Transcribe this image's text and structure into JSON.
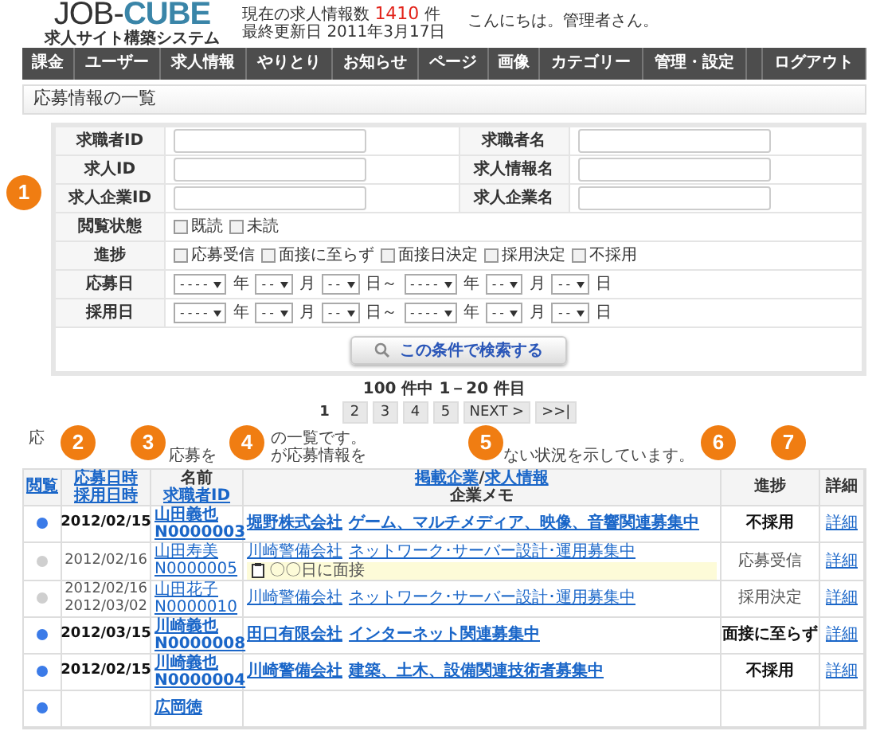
{
  "header": {
    "logo_main": "JOB-",
    "logo_accent": "CUBE",
    "logo_sub": "求人サイト構築システム",
    "count_label": "現在の求人情報数",
    "count": "1410",
    "count_unit": "件",
    "updated_label": "最終更新日",
    "updated": "2011年3月17日",
    "greeting": "こんにちは。管理者さん。"
  },
  "nav": [
    {
      "kind": "link",
      "label": "課金"
    },
    {
      "kind": "link",
      "label": "ユーザー"
    },
    {
      "kind": "link",
      "label": "求人情報"
    },
    {
      "kind": "link",
      "label": "やりとり"
    },
    {
      "kind": "link",
      "label": "お知らせ"
    },
    {
      "kind": "link",
      "label": "ページ"
    },
    {
      "kind": "link",
      "label": "画像"
    },
    {
      "kind": "link",
      "label": "カテゴリー"
    },
    {
      "kind": "link",
      "label": "管理・設定"
    },
    {
      "kind": "spacer"
    },
    {
      "kind": "link",
      "label": "ログアウト"
    }
  ],
  "page_title": "応募情報の一覧",
  "search": {
    "rows": [
      {
        "kind": "text_pair",
        "cells": [
          {
            "label": "求職者ID"
          },
          {
            "label": "求職者名"
          }
        ]
      },
      {
        "kind": "text_pair",
        "cells": [
          {
            "label": "求人ID"
          },
          {
            "label": "求人情報名"
          }
        ]
      },
      {
        "kind": "text_pair",
        "cells": [
          {
            "label": "求人企業ID"
          },
          {
            "label": "求人企業名"
          }
        ]
      },
      {
        "kind": "checks",
        "label": "閲覧状態",
        "options": [
          {
            "label": "既読",
            "checked": false
          },
          {
            "label": "未読",
            "checked": false
          }
        ]
      },
      {
        "kind": "checks",
        "label": "進捗",
        "options": [
          {
            "label": "応募受信",
            "checked": false
          },
          {
            "label": "面接に至らず",
            "checked": false
          },
          {
            "label": "面接日決定",
            "checked": false
          },
          {
            "label": "採用決定",
            "checked": false
          },
          {
            "label": "不採用",
            "checked": false
          }
        ]
      },
      {
        "kind": "dates",
        "label": "応募日",
        "parts": [
          {
            "kind": "select",
            "text": "----"
          },
          {
            "kind": "unit",
            "text": "年"
          },
          {
            "kind": "select",
            "text": "--"
          },
          {
            "kind": "unit",
            "text": "月"
          },
          {
            "kind": "select",
            "text": "--"
          },
          {
            "kind": "unit",
            "text": "日～"
          },
          {
            "kind": "select",
            "text": "----"
          },
          {
            "kind": "unit",
            "text": "年"
          },
          {
            "kind": "select",
            "text": "--"
          },
          {
            "kind": "unit",
            "text": "月"
          },
          {
            "kind": "select",
            "text": "--"
          },
          {
            "kind": "unit",
            "text": "日"
          }
        ]
      },
      {
        "kind": "dates",
        "label": "採用日",
        "parts": [
          {
            "kind": "select",
            "text": "----"
          },
          {
            "kind": "unit",
            "text": "年"
          },
          {
            "kind": "select",
            "text": "--"
          },
          {
            "kind": "unit",
            "text": "月"
          },
          {
            "kind": "select",
            "text": "--"
          },
          {
            "kind": "unit",
            "text": "日～"
          },
          {
            "kind": "select",
            "text": "----"
          },
          {
            "kind": "unit",
            "text": "年"
          },
          {
            "kind": "select",
            "text": "--"
          },
          {
            "kind": "unit",
            "text": "月"
          },
          {
            "kind": "select",
            "text": "--"
          },
          {
            "kind": "unit",
            "text": "日"
          }
        ]
      }
    ],
    "button": "この条件で検索する"
  },
  "pagination": {
    "summary": "100 件中 1－20 件目",
    "pages": [
      {
        "label": "1",
        "selected": true
      },
      {
        "label": "2",
        "selected": false
      },
      {
        "label": "3",
        "selected": false
      },
      {
        "label": "4",
        "selected": false
      },
      {
        "label": "5",
        "selected": false
      },
      {
        "label": "NEXT >",
        "selected": false
      },
      {
        "label": ">>|",
        "selected": false
      }
    ]
  },
  "description": [
    [
      "応",
      "の一覧です。"
    ],
    [
      "応募を",
      "が応募情報を",
      "ない状況を示しています。"
    ]
  ],
  "callouts": [
    "1",
    "2",
    "3",
    "4",
    "5",
    "6",
    "7"
  ],
  "table": {
    "columns": [
      {
        "lines": [
          {
            "text": "閲覧",
            "link": true
          }
        ]
      },
      {
        "lines": [
          {
            "text": "応募日時",
            "link": true
          },
          {
            "text": "採用日時",
            "link": true
          }
        ]
      },
      {
        "lines": [
          {
            "text": "名前",
            "link": false
          },
          {
            "text": "求職者ID",
            "link": true
          }
        ]
      },
      {
        "lines": [
          {
            "text": "掲載企業",
            "link": true
          },
          {
            "text": " / ",
            "link": false
          },
          {
            "text": "求人情報",
            "link": true
          },
          {
            "text": "企業メモ",
            "link": false
          }
        ]
      },
      {
        "lines": [
          {
            "text": "進捗",
            "link": false
          }
        ]
      },
      {
        "lines": [
          {
            "text": "詳細",
            "link": false
          }
        ]
      }
    ],
    "rows": [
      {
        "unread": true,
        "dates": [
          "2012/02/15"
        ],
        "name": "山田義也",
        "seeker_id": "N0000003",
        "company": "堀野株式会社",
        "job": "ゲーム、マルチメディア、映像、音響関連募集中",
        "status": "不採用",
        "detail": "詳細"
      },
      {
        "unread": false,
        "dates": [
          "2012/02/16"
        ],
        "name": "山田寿美",
        "seeker_id": "N0000005",
        "company": "川崎警備会社",
        "job": "ネットワーク･サーバー設計･運用募集中",
        "memo": "〇〇日に面接",
        "status": "応募受信",
        "detail": "詳細"
      },
      {
        "unread": false,
        "dates": [
          "2012/02/16",
          "2012/03/02"
        ],
        "name": "山田花子",
        "seeker_id": "N0000010",
        "company": "川崎警備会社",
        "job": "ネットワーク･サーバー設計･運用募集中",
        "status": "採用決定",
        "detail": "詳細"
      },
      {
        "unread": true,
        "dates": [
          "2012/03/15"
        ],
        "name": "川崎義也",
        "seeker_id": "N0000008",
        "company": "田口有限会社",
        "job": "インターネット関連募集中",
        "status": "面接に至らず",
        "detail": "詳細"
      },
      {
        "unread": true,
        "dates": [
          "2012/02/15"
        ],
        "name": "川崎義也",
        "seeker_id": "N0000004",
        "company": "川崎警備会社",
        "job": "建築、土木、設備関連技術者募集中",
        "status": "不採用",
        "detail": "詳細"
      },
      {
        "unread": true,
        "name": "広岡徳"
      }
    ]
  }
}
